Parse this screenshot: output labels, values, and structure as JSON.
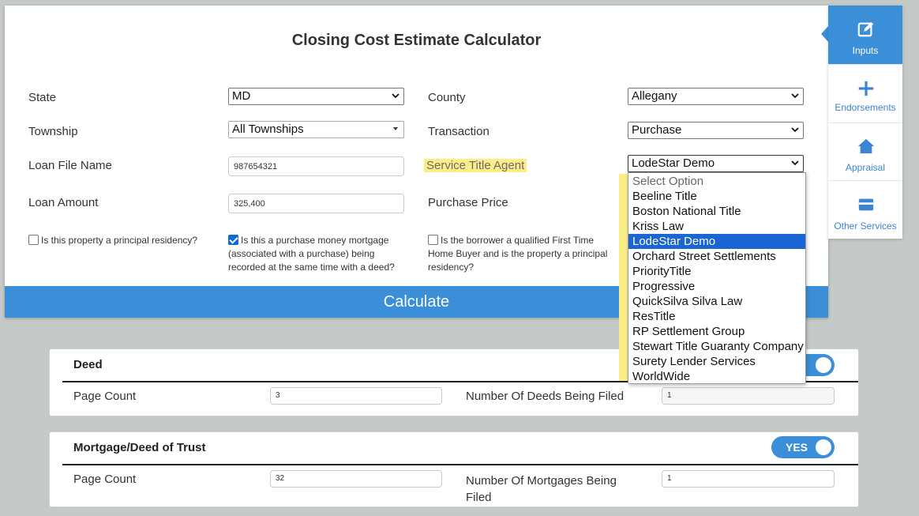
{
  "card": {
    "title": "Closing Cost Estimate Calculator",
    "state_label": "State",
    "state_value": "MD",
    "county_label": "County",
    "county_value": "Allegany",
    "township_label": "Township",
    "township_value": "All Townships",
    "transaction_label": "Transaction",
    "transaction_value": "Purchase",
    "loan_file_label": "Loan File Name",
    "loan_file_value": "987654321",
    "service_agent_label": "Service Title Agent",
    "service_agent_value": "LodeStar Demo",
    "loan_amount_label": "Loan Amount",
    "loan_amount_value": "325,400",
    "purchase_price_label": "Purchase Price",
    "chk_principal": "Is this property a principal residency?",
    "chk_purchase_money": "Is this a purchase money mortgage (associated with a purchase) being recorded at the same time with a deed?",
    "chk_first_time": "Is the borrower a qualified First Time Home Buyer and is the property a principal residency?",
    "calculate_label": "Calculate"
  },
  "checkbox_states": {
    "principal": false,
    "purchase_money": true,
    "first_time": false
  },
  "sidenav": {
    "items": [
      {
        "label": "Inputs",
        "icon": "edit-icon",
        "active": true
      },
      {
        "label": "Endorsements",
        "icon": "plus-icon",
        "active": false
      },
      {
        "label": "Appraisal",
        "icon": "home-icon",
        "active": false
      },
      {
        "label": "Other Services",
        "icon": "card-icon",
        "active": false
      }
    ]
  },
  "dropdown": {
    "options": [
      "Select Option",
      "Beeline Title",
      "Boston National Title",
      "Kriss Law",
      "LodeStar Demo",
      "Orchard Street Settlements",
      "PriorityTitle",
      "Progressive",
      "QuickSilva Silva Law",
      "ResTitle",
      "RP Settlement Group",
      "Stewart Title Guaranty Company",
      "Surety Lender Services",
      "WorldWide"
    ],
    "selected": "LodeStar Demo"
  },
  "deed": {
    "title": "Deed",
    "toggle_label": "S",
    "page_count_label": "Page Count",
    "page_count_value": "3",
    "num_label": "Number Of Deeds Being Filed",
    "num_value": "1"
  },
  "mortgage": {
    "title": "Mortgage/Deed of Trust",
    "toggle_label": "YES",
    "page_count_label": "Page Count",
    "page_count_value": "32",
    "num_label_line1": "Number Of Mortgages Being",
    "num_label_line2": "Filed",
    "num_value": "1"
  },
  "colors": {
    "accent": "#3a8fd8",
    "highlight": "#fcee86",
    "selected_option": "#1a64d3"
  }
}
